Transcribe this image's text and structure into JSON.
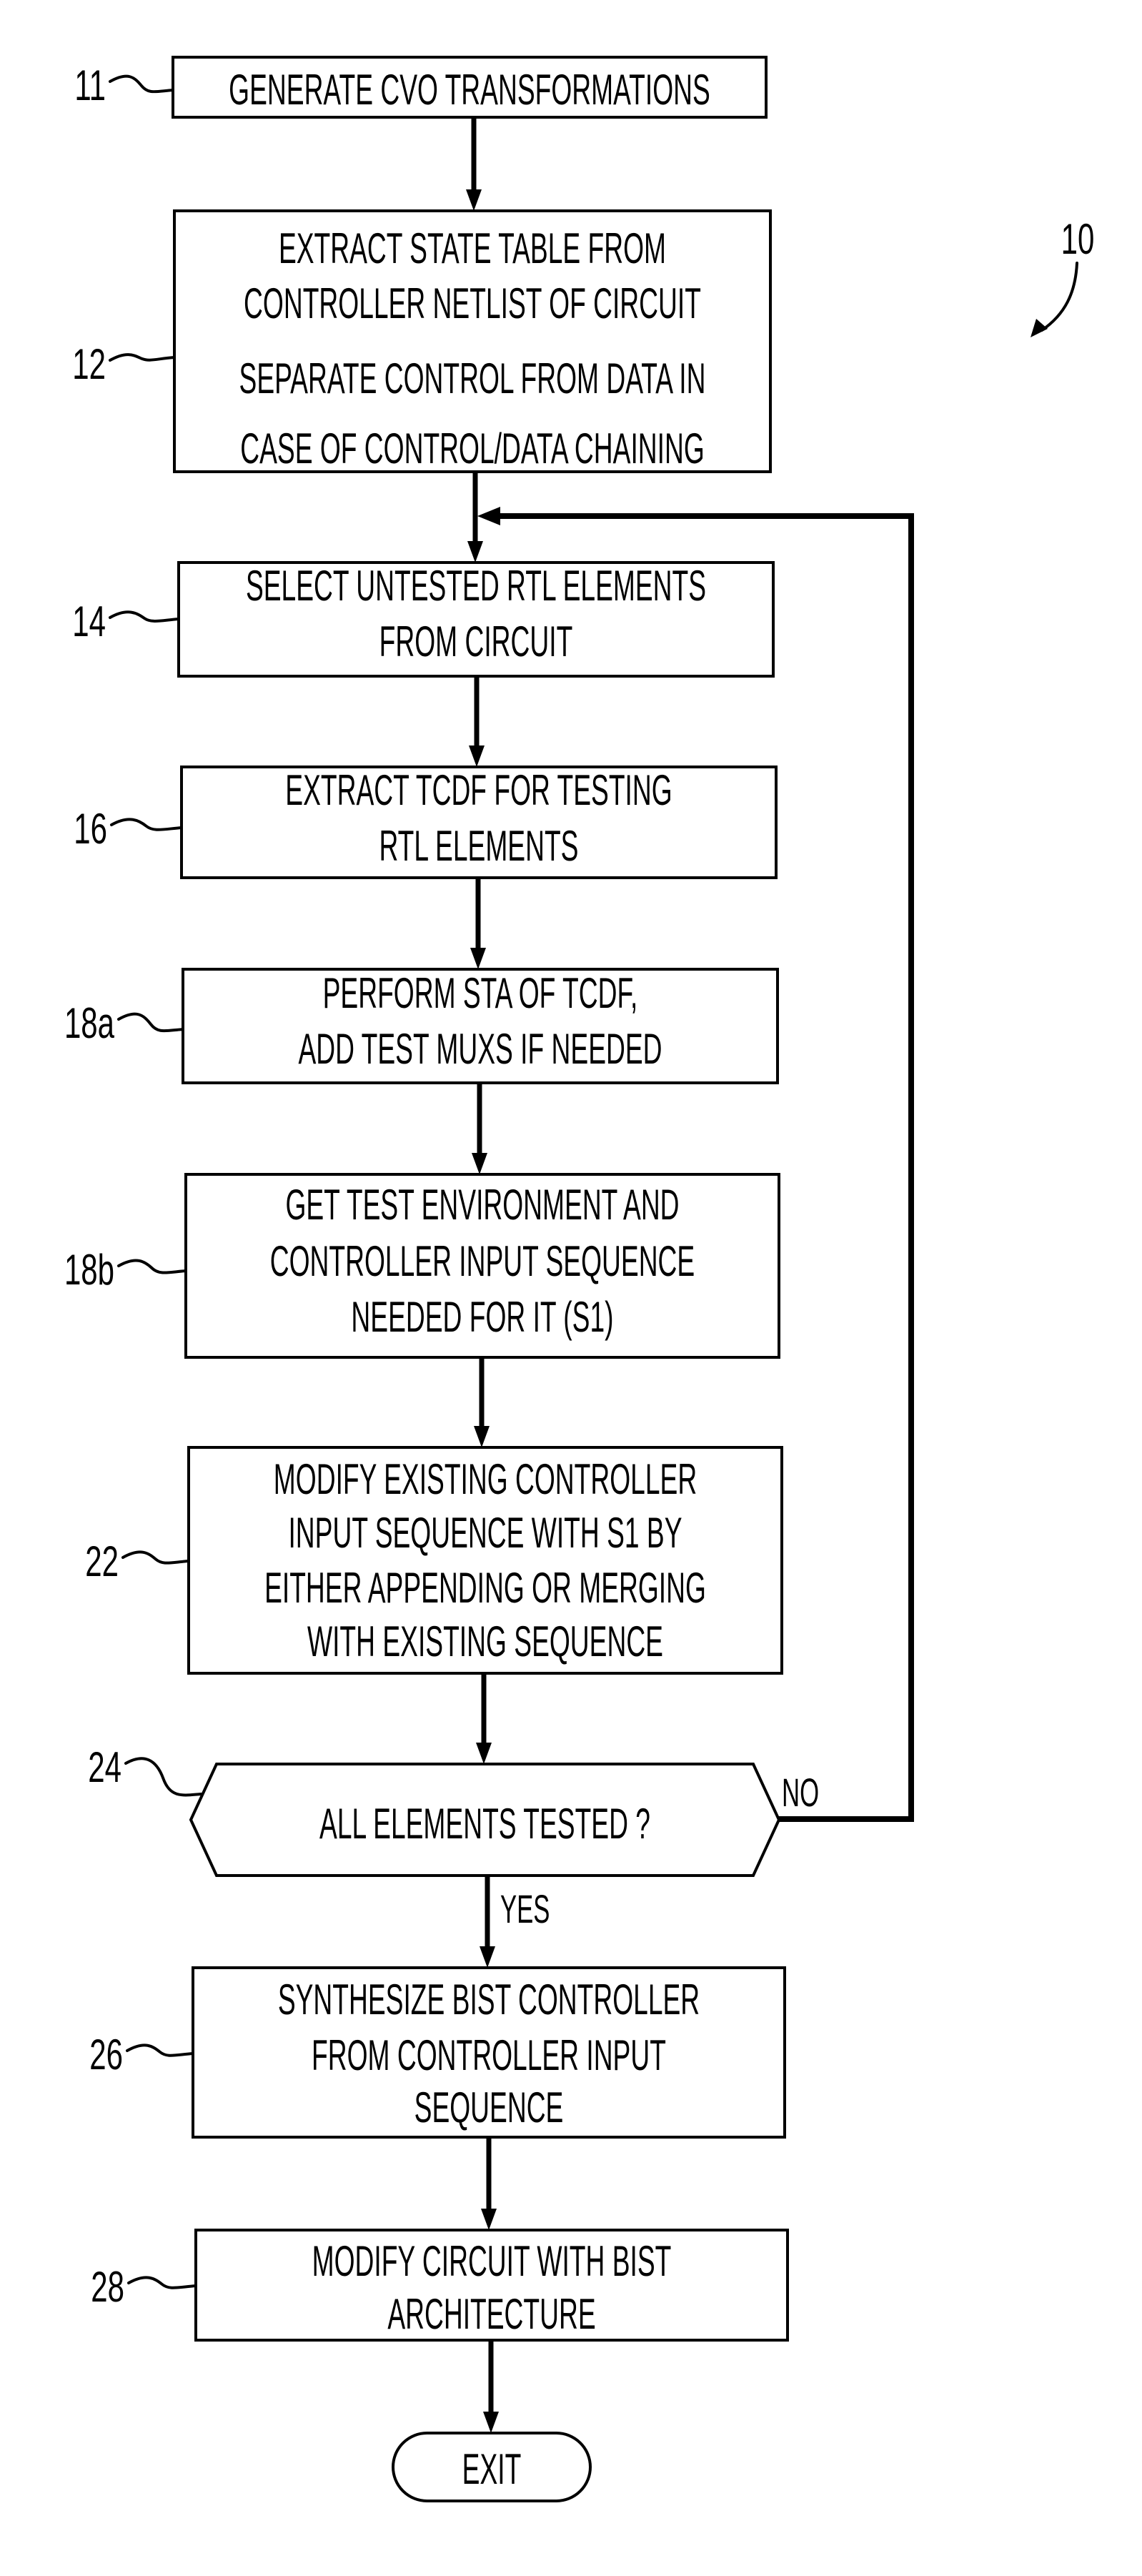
{
  "figure": {
    "reference_numeral": "10",
    "steps": [
      {
        "id": "11",
        "type": "process",
        "lines": [
          "GENERATE CVO TRANSFORMATIONS"
        ]
      },
      {
        "id": "12",
        "type": "process",
        "lines": [
          "EXTRACT STATE TABLE FROM",
          "CONTROLLER NETLIST OF CIRCUIT",
          "SEPARATE CONTROL FROM DATA IN",
          "CASE OF CONTROL/DATA CHAINING"
        ]
      },
      {
        "id": "14",
        "type": "process",
        "lines": [
          "SELECT UNTESTED RTL ELEMENTS",
          "FROM CIRCUIT"
        ]
      },
      {
        "id": "16",
        "type": "process",
        "lines": [
          "EXTRACT TCDF FOR TESTING",
          "RTL ELEMENTS"
        ]
      },
      {
        "id": "18a",
        "type": "process",
        "lines": [
          "PERFORM STA OF TCDF,",
          "ADD TEST MUXS IF NEEDED"
        ]
      },
      {
        "id": "18b",
        "type": "process",
        "lines": [
          "GET TEST ENVIRONMENT AND",
          "CONTROLLER INPUT SEQUENCE",
          "NEEDED FOR IT (S1)"
        ]
      },
      {
        "id": "22",
        "type": "process",
        "lines": [
          "MODIFY EXISTING CONTROLLER",
          "INPUT SEQUENCE WITH S1 BY",
          "EITHER APPENDING OR MERGING",
          "WITH EXISTING SEQUENCE"
        ]
      },
      {
        "id": "24",
        "type": "decision",
        "lines": [
          "ALL ELEMENTS TESTED ?"
        ]
      },
      {
        "id": "26",
        "type": "process",
        "lines": [
          "SYNTHESIZE BIST CONTROLLER",
          "FROM CONTROLLER INPUT",
          "SEQUENCE"
        ]
      },
      {
        "id": "28",
        "type": "process",
        "lines": [
          "MODIFY CIRCUIT WITH BIST",
          "ARCHITECTURE"
        ]
      },
      {
        "id": "exit",
        "type": "terminal",
        "lines": [
          "EXIT"
        ]
      }
    ],
    "branches": {
      "yes_label": "YES",
      "no_label": "NO"
    },
    "edges": [
      {
        "from": "11",
        "to": "12"
      },
      {
        "from": "12",
        "to": "14"
      },
      {
        "from": "14",
        "to": "16"
      },
      {
        "from": "16",
        "to": "18a"
      },
      {
        "from": "18a",
        "to": "18b"
      },
      {
        "from": "18b",
        "to": "22"
      },
      {
        "from": "22",
        "to": "24"
      },
      {
        "from": "24",
        "to": "26",
        "label": "YES"
      },
      {
        "from": "24",
        "to": "14",
        "label": "NO"
      },
      {
        "from": "26",
        "to": "28"
      },
      {
        "from": "28",
        "to": "exit"
      }
    ]
  }
}
